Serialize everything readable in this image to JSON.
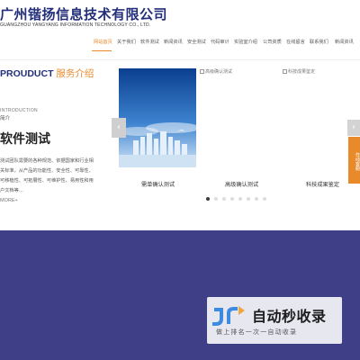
{
  "header": {
    "company_name": "广州锴扬信息技术有限公司",
    "company_en": "GUANGZHOU YANGYANG INFORMATION TECHNOLOGY CO., LTD."
  },
  "nav": {
    "items": [
      {
        "label": "网站首页",
        "active": true
      },
      {
        "label": "关于我们",
        "active": false
      },
      {
        "label": "软件测试",
        "active": false
      },
      {
        "label": "新闻资讯",
        "active": false
      },
      {
        "label": "安全测试",
        "active": false
      },
      {
        "label": "代码审计",
        "active": false
      },
      {
        "label": "实验室介绍",
        "active": false
      },
      {
        "label": "公司资质",
        "active": false
      },
      {
        "label": "在线留言",
        "active": false
      },
      {
        "label": "联系我们",
        "active": false
      },
      {
        "label": "新闻资讯",
        "active": false
      }
    ],
    "accent_color": "#e8892a"
  },
  "services": {
    "title_en": "PROUDUCT",
    "title_cn": "服务介绍",
    "intro_en": "INTRODUCTION",
    "intro_cn": "简介",
    "current_title": "软件测试",
    "description": "测试团队需要的各种规范、依据国家和行业相关标准，从产品的功能性、安全性、可靠性、可移植性、可拓展性、可维护性、易用性和用户文档等…",
    "more_label": "MORE+"
  },
  "carousel": {
    "cards": [
      {
        "label": "需单确认测试",
        "image_alt": "",
        "image_state": "loaded",
        "image_icon": "city-skyline-image"
      },
      {
        "label": "高级确认测试",
        "image_alt": "高级确认测试",
        "image_state": "broken",
        "image_icon": "broken-image-icon"
      },
      {
        "label": "科技成果鉴定",
        "image_alt": "科技成果鉴定",
        "image_state": "broken",
        "image_icon": "broken-image-icon"
      }
    ],
    "prev_icon": "chevron-left-icon",
    "next_icon": "chevron-right-icon",
    "dots_total": 8,
    "active_dot": 1
  },
  "side_tab": {
    "label": "在线客服"
  },
  "watermark": {
    "title": "自动秒收录",
    "subtitle": "做上排名一次一自动收录"
  },
  "colors": {
    "brand_blue": "#232f7a",
    "accent_orange": "#e8892a",
    "band_purple": "#3e3f87"
  }
}
